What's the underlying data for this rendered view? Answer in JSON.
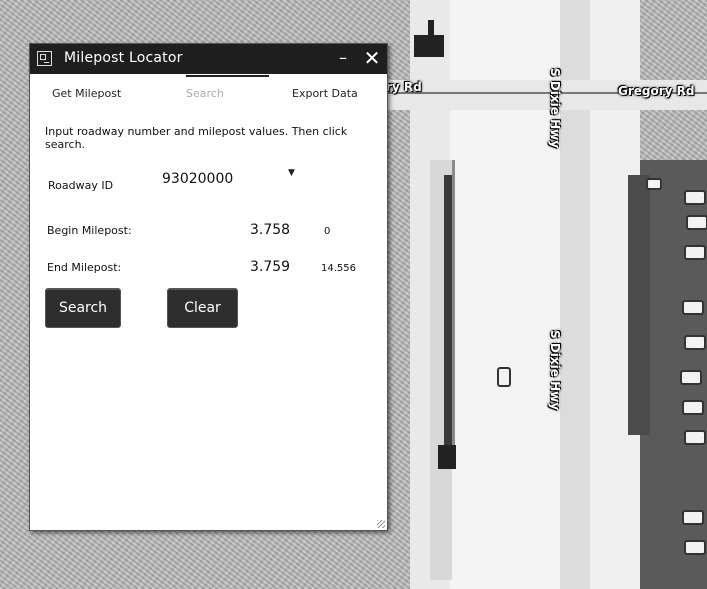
{
  "map": {
    "labels": {
      "road_gregory_left": "ry Rd",
      "road_gregory_right": "Gregory Rd",
      "hwy_top": "S Dixie Hwy",
      "hwy_mid": "S Dixie Hwy"
    }
  },
  "panel": {
    "title": "Milepost Locator",
    "minimize_glyph": "–",
    "close_glyph": "✕",
    "tabs": [
      {
        "label": "Get Milepost",
        "active": false
      },
      {
        "label": "Search",
        "active": true
      },
      {
        "label": "Export Data",
        "active": false
      }
    ],
    "instructions": "Input roadway number and milepost values. Then click search.",
    "roadway": {
      "label": "Roadway ID",
      "value": "93020000",
      "arrow": "▼"
    },
    "begin": {
      "label": "Begin Milepost:",
      "value": "3.758",
      "min": "0"
    },
    "end": {
      "label": "End Milepost:",
      "value": "3.759",
      "max": "14.556"
    },
    "buttons": {
      "search": "Search",
      "clear": "Clear"
    }
  }
}
